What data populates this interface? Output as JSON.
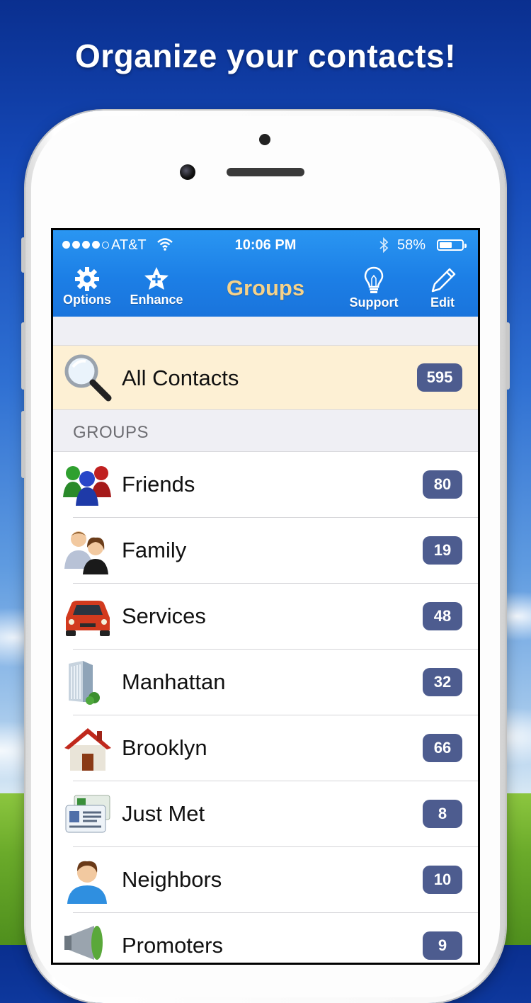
{
  "headline": "Organize your contacts!",
  "status_bar": {
    "carrier": "AT&T",
    "time": "10:06 PM",
    "battery_percent": "58%",
    "battery_level": 0.58
  },
  "nav": {
    "title": "Groups",
    "options_label": "Options",
    "enhance_label": "Enhance",
    "support_label": "Support",
    "edit_label": "Edit"
  },
  "all_contacts": {
    "label": "All Contacts",
    "count": "595"
  },
  "section_header": "GROUPS",
  "groups": [
    {
      "label": "Friends",
      "count": "80",
      "icon": "people-group-icon"
    },
    {
      "label": "Family",
      "count": "19",
      "icon": "family-icon"
    },
    {
      "label": "Services",
      "count": "48",
      "icon": "car-icon"
    },
    {
      "label": "Manhattan",
      "count": "32",
      "icon": "building-icon"
    },
    {
      "label": "Brooklyn",
      "count": "66",
      "icon": "house-icon"
    },
    {
      "label": "Just Met",
      "count": "8",
      "icon": "business-card-icon"
    },
    {
      "label": "Neighbors",
      "count": "10",
      "icon": "person-icon"
    },
    {
      "label": "Promoters",
      "count": "9",
      "icon": "megaphone-icon"
    }
  ],
  "colors": {
    "nav_blue": "#1c7fe6",
    "title_gold": "#f5d28a",
    "badge": "#4d5c8f",
    "highlight_row": "#fdf0d4"
  }
}
